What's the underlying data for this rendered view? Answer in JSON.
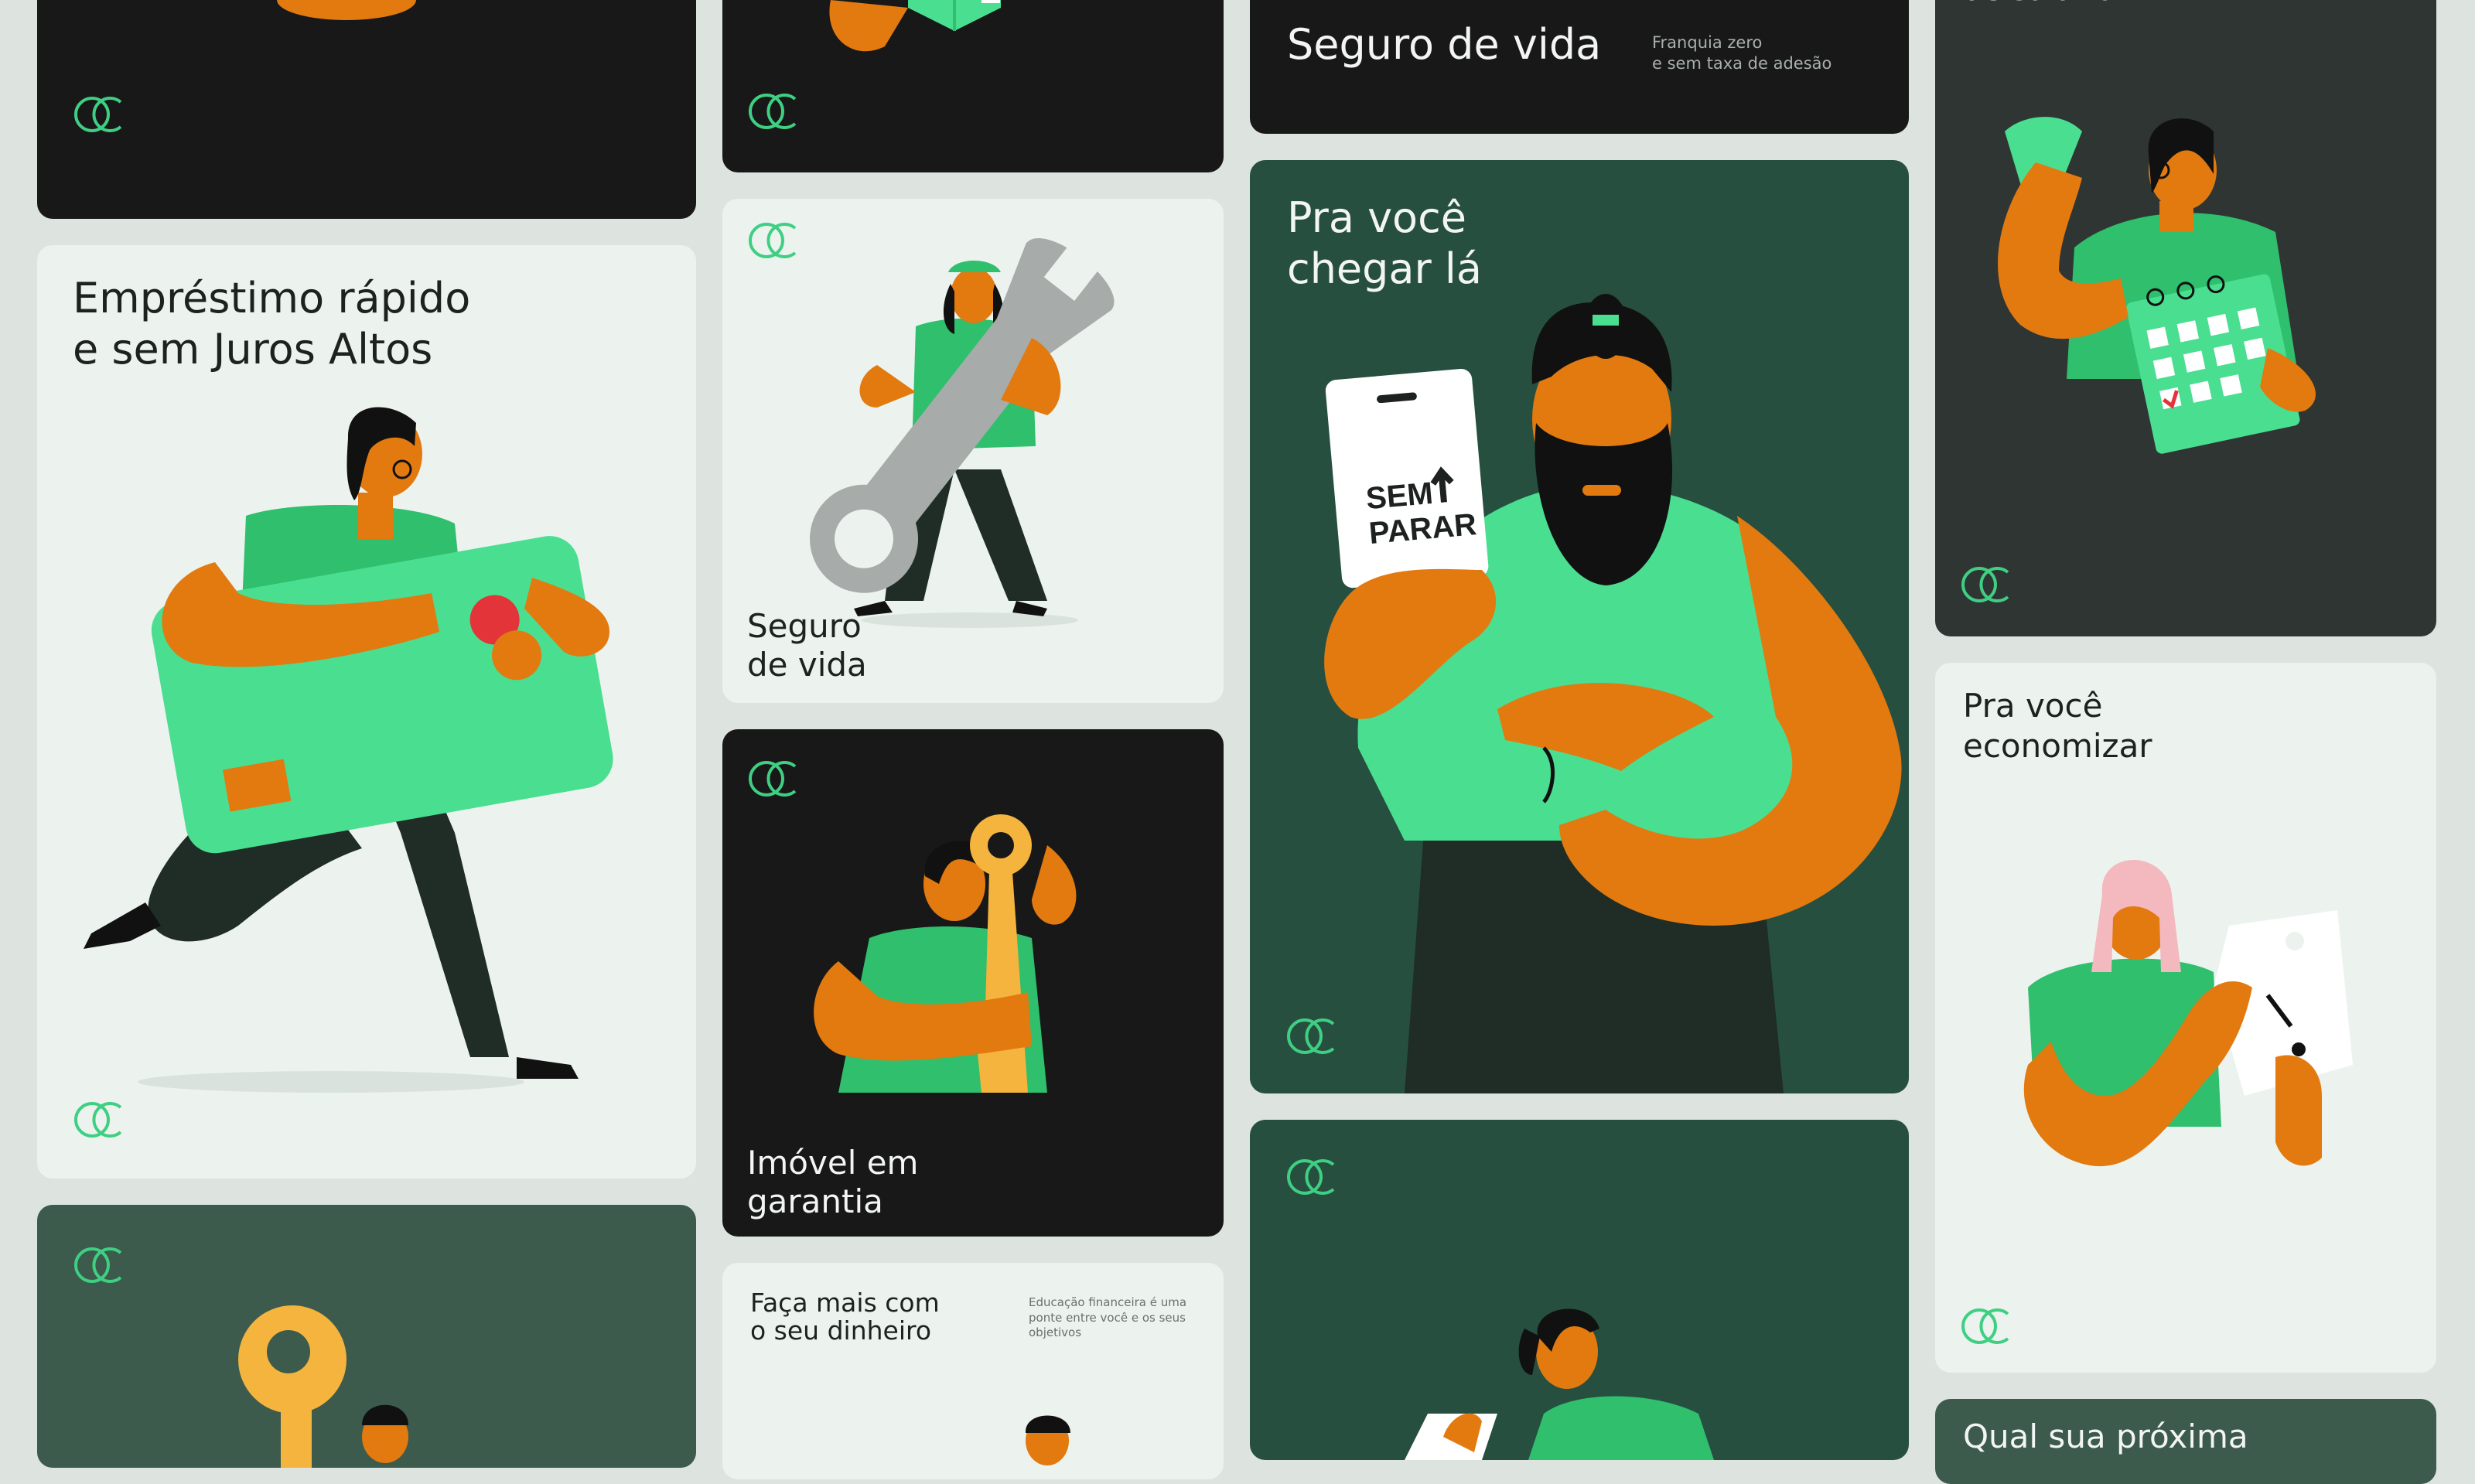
{
  "colors": {
    "accent_green": "#4ade91",
    "accent_orange": "#e27a10",
    "card_dark": "#181818",
    "card_pale": "#ecf3ef",
    "card_forest": "#264f3f",
    "card_moss": "#3c5b4d",
    "card_slate": "#2f3533"
  },
  "brand": {
    "logo_icon": "brand-logo-icon"
  },
  "cards": {
    "loan": {
      "title": "Empréstimo rápido\ne sem Juros Altos"
    },
    "insurance_small": {
      "title": "Seguro\nde vida"
    },
    "property": {
      "title": "Imóvel em\ngarantia"
    },
    "edu": {
      "title": "Faça mais com\no seu dinheiro",
      "note": "Educação financeira é uma\nponte entre você e os seus\nobjetivos"
    },
    "insurance_banner": {
      "title": "Seguro de vida",
      "note": "Franquia zero\ne sem taxa de adesão"
    },
    "reach": {
      "title": "Pra você\nchegar lá",
      "tag_text": "SEM\nPARAR"
    },
    "salary": {
      "title": "de salário"
    },
    "save": {
      "title": "Pra você\neconomizar"
    },
    "next": {
      "title": "Qual sua próxima"
    }
  }
}
